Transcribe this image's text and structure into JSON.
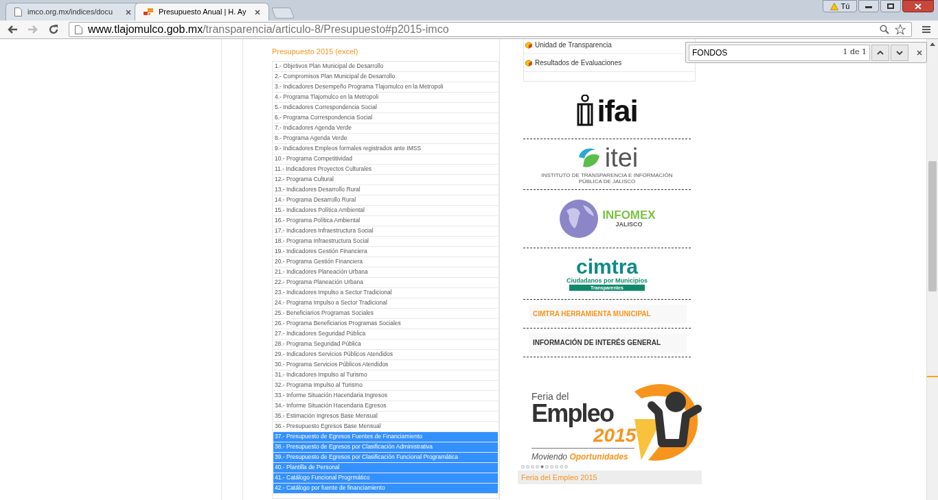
{
  "browser": {
    "tabs": [
      {
        "title": "imco.org.mx/indices/docu",
        "selected": false
      },
      {
        "title": "Presupuesto Anual | H. Ay",
        "selected": true
      }
    ],
    "user_badge": "Tú",
    "url": {
      "host": "www.tlajomulco.gob.mx",
      "path": "/transparencia/articulo-8/Presupuesto#p2015-imco"
    }
  },
  "find_bar": {
    "query": "FONDOS",
    "count": "1 de 1"
  },
  "content": {
    "title": "Presupuesto 2015 (excel)",
    "rows": [
      {
        "label": "1.- Objetivos Plan Municipal de Desarrollo",
        "selected": false
      },
      {
        "label": "2.- Compromisos Plan Municipal de Desarrollo",
        "selected": false
      },
      {
        "label": "3.- Indicadores Desempeño Programa Tlajomulco en la Metropoli",
        "selected": false
      },
      {
        "label": "4.- Programa Tlajomulco en la Metropoli",
        "selected": false
      },
      {
        "label": "5.- Indicadores Correspondencia Social",
        "selected": false
      },
      {
        "label": "6.- Programa Correspondencia Social",
        "selected": false
      },
      {
        "label": "7.- Indicadores Agenda Verde",
        "selected": false
      },
      {
        "label": "8.- Programa Agenda Verde",
        "selected": false
      },
      {
        "label": "9.- Indicadores Empleos formales registrados ante IMSS",
        "selected": false
      },
      {
        "label": "10.- Programa Competitividad",
        "selected": false
      },
      {
        "label": "11.- Indicadores Proyectos Culturales",
        "selected": false
      },
      {
        "label": "12.- Programa Cultural",
        "selected": false
      },
      {
        "label": "13.- Indicadores Desarrollo Rural",
        "selected": false
      },
      {
        "label": "14.- Programa Desarrollo Rural",
        "selected": false
      },
      {
        "label": "15.- Indicadores Política Ambiental",
        "selected": false
      },
      {
        "label": "16.- Programa Política Ambiental",
        "selected": false
      },
      {
        "label": "17.- Indicadores Infraestructura Social",
        "selected": false
      },
      {
        "label": "18.- Programa Infraestructura Social",
        "selected": false
      },
      {
        "label": "19.- Indicadores Gestión Financiera",
        "selected": false
      },
      {
        "label": "20.- Programa Gestión Financiera",
        "selected": false
      },
      {
        "label": "21.- Indicadores Planeación Urbana",
        "selected": false
      },
      {
        "label": "22.- Programa Planeación Urbana",
        "selected": false
      },
      {
        "label": "23.- Indicadores Impulso a Sector Tradicional",
        "selected": false
      },
      {
        "label": "24.- Programa Impulso a Sector Tradicional",
        "selected": false
      },
      {
        "label": "25.- Beneficiarios Programas Sociales",
        "selected": false
      },
      {
        "label": "26.- Programa Beneficiarios Programas Sociales",
        "selected": false
      },
      {
        "label": "27.- Indicadores Seguridad Pública",
        "selected": false
      },
      {
        "label": "28.- Programa Seguridad Pública",
        "selected": false
      },
      {
        "label": "29.- Indicadores Servicios Públicos Atendidos",
        "selected": false
      },
      {
        "label": "30.- Programa Servicios Públicos Atendidos",
        "selected": false
      },
      {
        "label": "31.- Indicadores Impulso al Turismo",
        "selected": false
      },
      {
        "label": "32.- Programa Impulso al Turismo",
        "selected": false
      },
      {
        "label": "33.- Informe Situación Hacendaria Ingresos",
        "selected": false
      },
      {
        "label": "34.- Informe Situación Hacendaria Egresos",
        "selected": false
      },
      {
        "label": "35.- Estimación Ingresos Base Mensual",
        "selected": false
      },
      {
        "label": "36.- Presupuesto Egresos Base Mensual",
        "selected": false
      },
      {
        "label": "37.- Presupuesto de Egresos Fuentes de Financiamiento",
        "selected": true
      },
      {
        "label": "38.- Presupuesto de Egresos por Clasificación Administrativa",
        "selected": true
      },
      {
        "label": "39.- Presupuesto de Egresos por Clasificación Funcional Programática",
        "selected": true
      },
      {
        "label": "40.- Plantilla de Personal",
        "selected": true
      },
      {
        "label": "41.- Catálogo Funcional Progrmático",
        "selected": true
      },
      {
        "label": "42.- Catálogo por fuente de financiamiento",
        "selected": true
      }
    ]
  },
  "sidebar": {
    "links": [
      {
        "label": "Unidad de Transparencia"
      },
      {
        "label": "Resultados de Evaluaciones"
      }
    ],
    "logos": [
      {
        "kind": "ifai",
        "name": "ifai"
      },
      {
        "kind": "itei",
        "name": "itei",
        "subtext": "INSTITUTO DE TRANSPARENCIA E INFORMACIÓN PÚBLICA DE JALISCO"
      },
      {
        "kind": "infomex",
        "name": "INFOMEX",
        "subtext": "JALISCO"
      },
      {
        "kind": "cimtra",
        "name": "cimtra",
        "subtext": "Ciudadanos por Municipios",
        "subtext2": "Transparentes"
      }
    ],
    "buttons": [
      {
        "label": "CIMTRA HERRAMIENTA MUNICIPAL",
        "color": "#f7941d"
      },
      {
        "label": "INFORMACIÓN DE INTERÉS GENERAL",
        "color": "#333333"
      }
    ],
    "banner": {
      "line1": "Feria del",
      "line2": "Empleo",
      "year": "2015",
      "tagline_a": "Moviendo",
      "tagline_b": "Oportunidades",
      "slides": [
        {
          "selected": false
        },
        {
          "selected": false
        },
        {
          "selected": false
        },
        {
          "selected": false
        },
        {
          "selected": true
        },
        {
          "selected": false
        },
        {
          "selected": false
        },
        {
          "selected": false
        },
        {
          "selected": false
        },
        {
          "selected": false
        }
      ],
      "caption": "Feria del Empleo 2015"
    }
  }
}
